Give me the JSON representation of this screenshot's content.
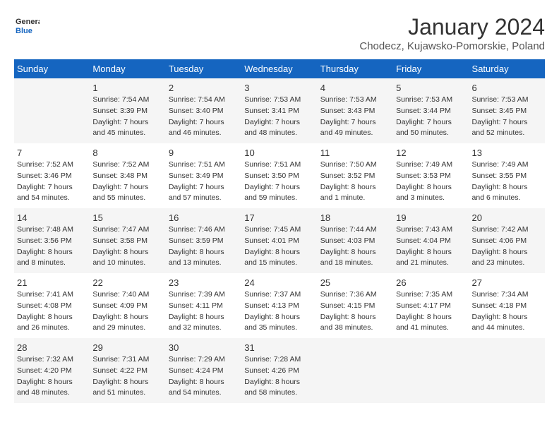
{
  "header": {
    "logo_general": "General",
    "logo_blue": "Blue",
    "month_title": "January 2024",
    "subtitle": "Chodecz, Kujawsko-Pomorskie, Poland"
  },
  "days_of_week": [
    "Sunday",
    "Monday",
    "Tuesday",
    "Wednesday",
    "Thursday",
    "Friday",
    "Saturday"
  ],
  "weeks": [
    [
      {
        "day": "",
        "info": ""
      },
      {
        "day": "1",
        "info": "Sunrise: 7:54 AM\nSunset: 3:39 PM\nDaylight: 7 hours\nand 45 minutes."
      },
      {
        "day": "2",
        "info": "Sunrise: 7:54 AM\nSunset: 3:40 PM\nDaylight: 7 hours\nand 46 minutes."
      },
      {
        "day": "3",
        "info": "Sunrise: 7:53 AM\nSunset: 3:41 PM\nDaylight: 7 hours\nand 48 minutes."
      },
      {
        "day": "4",
        "info": "Sunrise: 7:53 AM\nSunset: 3:43 PM\nDaylight: 7 hours\nand 49 minutes."
      },
      {
        "day": "5",
        "info": "Sunrise: 7:53 AM\nSunset: 3:44 PM\nDaylight: 7 hours\nand 50 minutes."
      },
      {
        "day": "6",
        "info": "Sunrise: 7:53 AM\nSunset: 3:45 PM\nDaylight: 7 hours\nand 52 minutes."
      }
    ],
    [
      {
        "day": "7",
        "info": "Sunrise: 7:52 AM\nSunset: 3:46 PM\nDaylight: 7 hours\nand 54 minutes."
      },
      {
        "day": "8",
        "info": "Sunrise: 7:52 AM\nSunset: 3:48 PM\nDaylight: 7 hours\nand 55 minutes."
      },
      {
        "day": "9",
        "info": "Sunrise: 7:51 AM\nSunset: 3:49 PM\nDaylight: 7 hours\nand 57 minutes."
      },
      {
        "day": "10",
        "info": "Sunrise: 7:51 AM\nSunset: 3:50 PM\nDaylight: 7 hours\nand 59 minutes."
      },
      {
        "day": "11",
        "info": "Sunrise: 7:50 AM\nSunset: 3:52 PM\nDaylight: 8 hours\nand 1 minute."
      },
      {
        "day": "12",
        "info": "Sunrise: 7:49 AM\nSunset: 3:53 PM\nDaylight: 8 hours\nand 3 minutes."
      },
      {
        "day": "13",
        "info": "Sunrise: 7:49 AM\nSunset: 3:55 PM\nDaylight: 8 hours\nand 6 minutes."
      }
    ],
    [
      {
        "day": "14",
        "info": "Sunrise: 7:48 AM\nSunset: 3:56 PM\nDaylight: 8 hours\nand 8 minutes."
      },
      {
        "day": "15",
        "info": "Sunrise: 7:47 AM\nSunset: 3:58 PM\nDaylight: 8 hours\nand 10 minutes."
      },
      {
        "day": "16",
        "info": "Sunrise: 7:46 AM\nSunset: 3:59 PM\nDaylight: 8 hours\nand 13 minutes."
      },
      {
        "day": "17",
        "info": "Sunrise: 7:45 AM\nSunset: 4:01 PM\nDaylight: 8 hours\nand 15 minutes."
      },
      {
        "day": "18",
        "info": "Sunrise: 7:44 AM\nSunset: 4:03 PM\nDaylight: 8 hours\nand 18 minutes."
      },
      {
        "day": "19",
        "info": "Sunrise: 7:43 AM\nSunset: 4:04 PM\nDaylight: 8 hours\nand 21 minutes."
      },
      {
        "day": "20",
        "info": "Sunrise: 7:42 AM\nSunset: 4:06 PM\nDaylight: 8 hours\nand 23 minutes."
      }
    ],
    [
      {
        "day": "21",
        "info": "Sunrise: 7:41 AM\nSunset: 4:08 PM\nDaylight: 8 hours\nand 26 minutes."
      },
      {
        "day": "22",
        "info": "Sunrise: 7:40 AM\nSunset: 4:09 PM\nDaylight: 8 hours\nand 29 minutes."
      },
      {
        "day": "23",
        "info": "Sunrise: 7:39 AM\nSunset: 4:11 PM\nDaylight: 8 hours\nand 32 minutes."
      },
      {
        "day": "24",
        "info": "Sunrise: 7:37 AM\nSunset: 4:13 PM\nDaylight: 8 hours\nand 35 minutes."
      },
      {
        "day": "25",
        "info": "Sunrise: 7:36 AM\nSunset: 4:15 PM\nDaylight: 8 hours\nand 38 minutes."
      },
      {
        "day": "26",
        "info": "Sunrise: 7:35 AM\nSunset: 4:17 PM\nDaylight: 8 hours\nand 41 minutes."
      },
      {
        "day": "27",
        "info": "Sunrise: 7:34 AM\nSunset: 4:18 PM\nDaylight: 8 hours\nand 44 minutes."
      }
    ],
    [
      {
        "day": "28",
        "info": "Sunrise: 7:32 AM\nSunset: 4:20 PM\nDaylight: 8 hours\nand 48 minutes."
      },
      {
        "day": "29",
        "info": "Sunrise: 7:31 AM\nSunset: 4:22 PM\nDaylight: 8 hours\nand 51 minutes."
      },
      {
        "day": "30",
        "info": "Sunrise: 7:29 AM\nSunset: 4:24 PM\nDaylight: 8 hours\nand 54 minutes."
      },
      {
        "day": "31",
        "info": "Sunrise: 7:28 AM\nSunset: 4:26 PM\nDaylight: 8 hours\nand 58 minutes."
      },
      {
        "day": "",
        "info": ""
      },
      {
        "day": "",
        "info": ""
      },
      {
        "day": "",
        "info": ""
      }
    ]
  ]
}
